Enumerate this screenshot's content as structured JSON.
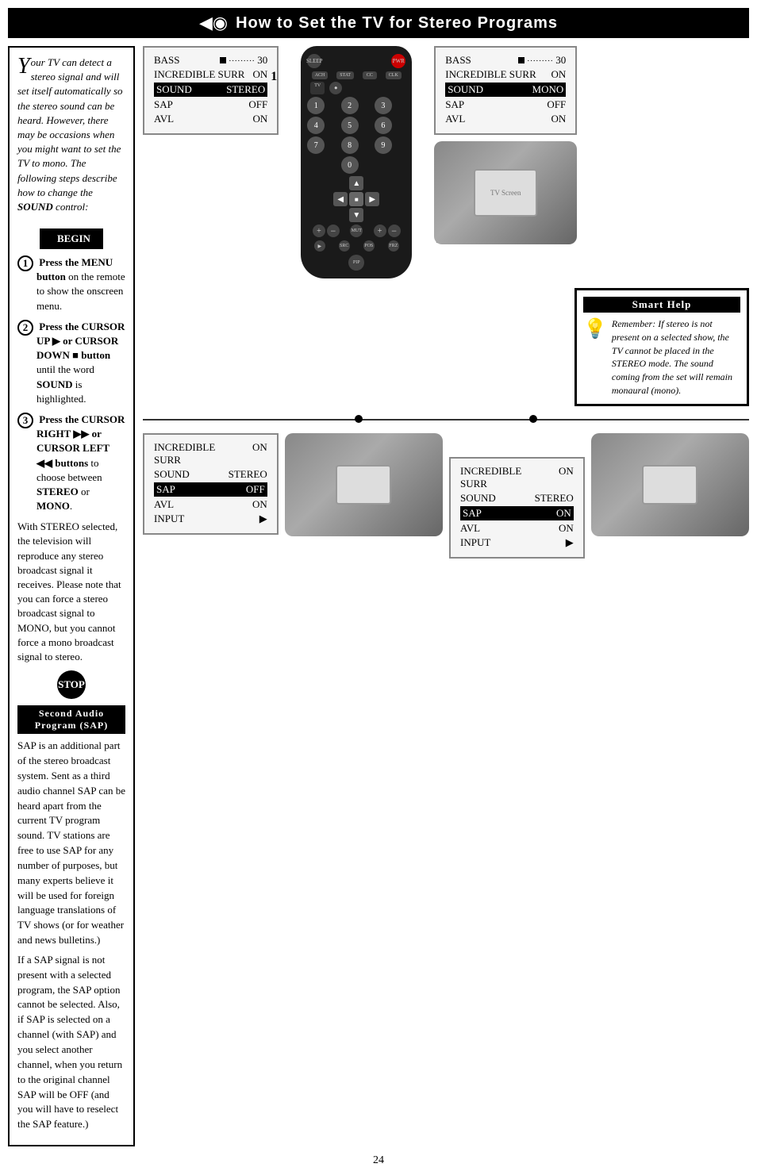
{
  "header": {
    "icon": "◀◀",
    "title": "How to Set the TV for Stereo Programs"
  },
  "intro": {
    "drop_cap": "Y",
    "text": "our TV can detect a stereo signal and will set itself automatically so the stereo sound can be heard. However, there may be occasions when you might want to set the TV to mono. The following steps describe how to change the SOUND control:"
  },
  "begin_label": "BEGIN",
  "steps": [
    {
      "num": "1",
      "text_parts": [
        "Press the ",
        "MENU button",
        " on the remote to show the onscreen menu."
      ]
    },
    {
      "num": "2",
      "text_parts": [
        "Press the ",
        "CURSOR UP",
        " ▶ or ",
        "CURSOR DOWN",
        " ■ button until the word ",
        "SOUND",
        " is highlighted."
      ]
    },
    {
      "num": "3",
      "text_parts": [
        "Press the ",
        "CURSOR RIGHT",
        " ▶▶ or ",
        "CURSOR LEFT",
        " ◀◀ buttons to choose between ",
        "STEREO",
        " or ",
        "MONO",
        "."
      ]
    }
  ],
  "stereo_note": "With STEREO selected, the television will reproduce any stereo broadcast signal it receives. Please note that you can force a stereo broadcast signal to MONO, but you cannot force a mono broadcast signal to stereo.",
  "stop_label": "STOP",
  "sap_title": "Second Audio Program (SAP)",
  "sap_paragraphs": [
    "SAP is an additional part of the stereo broadcast system. Sent as a third audio channel SAP can be heard apart from the current TV program sound. TV stations are free to use SAP for any number of purposes, but many experts believe it will be used for foreign language translations of TV shows (or for weather and news bulletins.)",
    "If a SAP signal is not present with a selected program, the SAP option cannot be selected. Also, if SAP is selected on a channel (with SAP) and you select another channel, when you return to the original channel SAP will be OFF (and you will have to reselect the SAP feature.)"
  ],
  "screen1": {
    "rows": [
      {
        "label": "BASS",
        "value": "30",
        "bar": true,
        "highlight": false
      },
      {
        "label": "INCREDIBLE SURR",
        "value": "ON",
        "bar": false,
        "highlight": false
      },
      {
        "label": "SOUND",
        "value": "STEREO",
        "bar": false,
        "highlight": true
      },
      {
        "label": "SAP",
        "value": "OFF",
        "bar": false,
        "highlight": false
      },
      {
        "label": "AVL",
        "value": "ON",
        "bar": false,
        "highlight": false
      }
    ]
  },
  "screen2": {
    "rows": [
      {
        "label": "BASS",
        "value": "30",
        "bar": true,
        "highlight": false
      },
      {
        "label": "INCREDIBLE SURR",
        "value": "ON",
        "bar": false,
        "highlight": false
      },
      {
        "label": "SOUND",
        "value": "MONO",
        "bar": false,
        "highlight": true
      },
      {
        "label": "SAP",
        "value": "OFF",
        "bar": false,
        "highlight": false
      },
      {
        "label": "AVL",
        "value": "ON",
        "bar": false,
        "highlight": false
      }
    ]
  },
  "screen3": {
    "rows": [
      {
        "label": "INCREDIBLE SURR",
        "value": "ON",
        "bar": false,
        "highlight": false
      },
      {
        "label": "SOUND",
        "value": "STEREO",
        "bar": false,
        "highlight": false
      },
      {
        "label": "SAP",
        "value": "OFF",
        "bar": false,
        "highlight": true
      },
      {
        "label": "AVL",
        "value": "ON",
        "bar": false,
        "highlight": false
      },
      {
        "label": "INPUT",
        "value": "▶",
        "bar": false,
        "highlight": false
      }
    ]
  },
  "screen4": {
    "rows": [
      {
        "label": "INCREDIBLE SURR",
        "value": "ON",
        "bar": false,
        "highlight": false
      },
      {
        "label": "SOUND",
        "value": "STEREO",
        "bar": false,
        "highlight": false
      },
      {
        "label": "SAP",
        "value": "ON",
        "bar": false,
        "highlight": true
      },
      {
        "label": "AVL",
        "value": "ON",
        "bar": false,
        "highlight": false
      },
      {
        "label": "INPUT",
        "value": "▶",
        "bar": false,
        "highlight": false
      }
    ]
  },
  "smart_help": {
    "title": "Smart Help",
    "text": "Remember: If stereo is not present on a selected show, the TV cannot be placed in the STEREO mode. The sound coming from the set will remain monaural (mono)."
  },
  "step_labels": [
    "1",
    "2",
    "3"
  ],
  "page_number": "24",
  "remote": {
    "buttons": {
      "sleep": "SLEEP",
      "power": "POWER",
      "input_row": [
        "ACH",
        "STATUS FIT",
        "CC",
        "CLOCK"
      ],
      "nums": [
        "1",
        "2",
        "3",
        "4",
        "5",
        "6",
        "7",
        "8",
        "9",
        "0"
      ],
      "dpad_up": "▲",
      "dpad_down": "▼",
      "dpad_left": "◀",
      "dpad_right": "▶",
      "dpad_center": "■",
      "vol_plus": "+",
      "vol_minus": "−",
      "ch_plus": "+",
      "ch_minus": "−",
      "mute": "MUTE",
      "bottom_row": [
        "PLAY",
        "SOURCE",
        "POSITION",
        "FREEZE"
      ],
      "pip_off": "PIP OFF"
    }
  }
}
